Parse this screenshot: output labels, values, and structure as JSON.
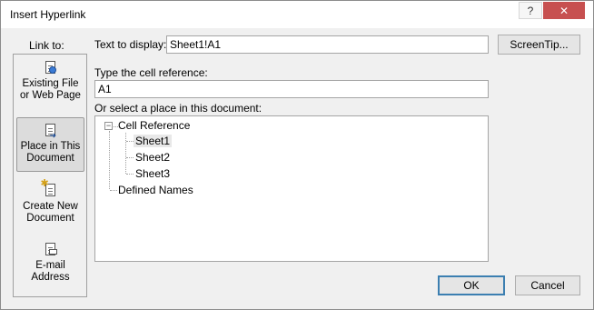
{
  "window": {
    "title": "Insert Hyperlink",
    "help_label": "?",
    "close_label": "✕"
  },
  "link_to": {
    "label": "Link to:",
    "items": [
      {
        "line1": "Existing File",
        "line2": "or Web Page",
        "icon": "existing-file-web-page-icon"
      },
      {
        "line1": "Place in This",
        "line2": "Document",
        "icon": "place-in-document-icon",
        "selected": true
      },
      {
        "line1": "Create New",
        "line2": "Document",
        "icon": "create-new-document-icon"
      },
      {
        "line1": "E-mail",
        "line2": "Address",
        "icon": "email-address-icon"
      }
    ]
  },
  "text_to_display": {
    "label": "Text to display:",
    "value": "Sheet1!A1"
  },
  "screentip_label": "ScreenTip...",
  "cell_reference": {
    "label": "Type the cell reference:",
    "value": "A1"
  },
  "place_selector": {
    "label": "Or select a place in this document:",
    "expander": "−",
    "root": "Cell Reference",
    "sheets": [
      "Sheet1",
      "Sheet2",
      "Sheet3"
    ],
    "selected_sheet": "Sheet1",
    "defined_names": "Defined Names"
  },
  "buttons": {
    "ok": "OK",
    "cancel": "Cancel"
  }
}
